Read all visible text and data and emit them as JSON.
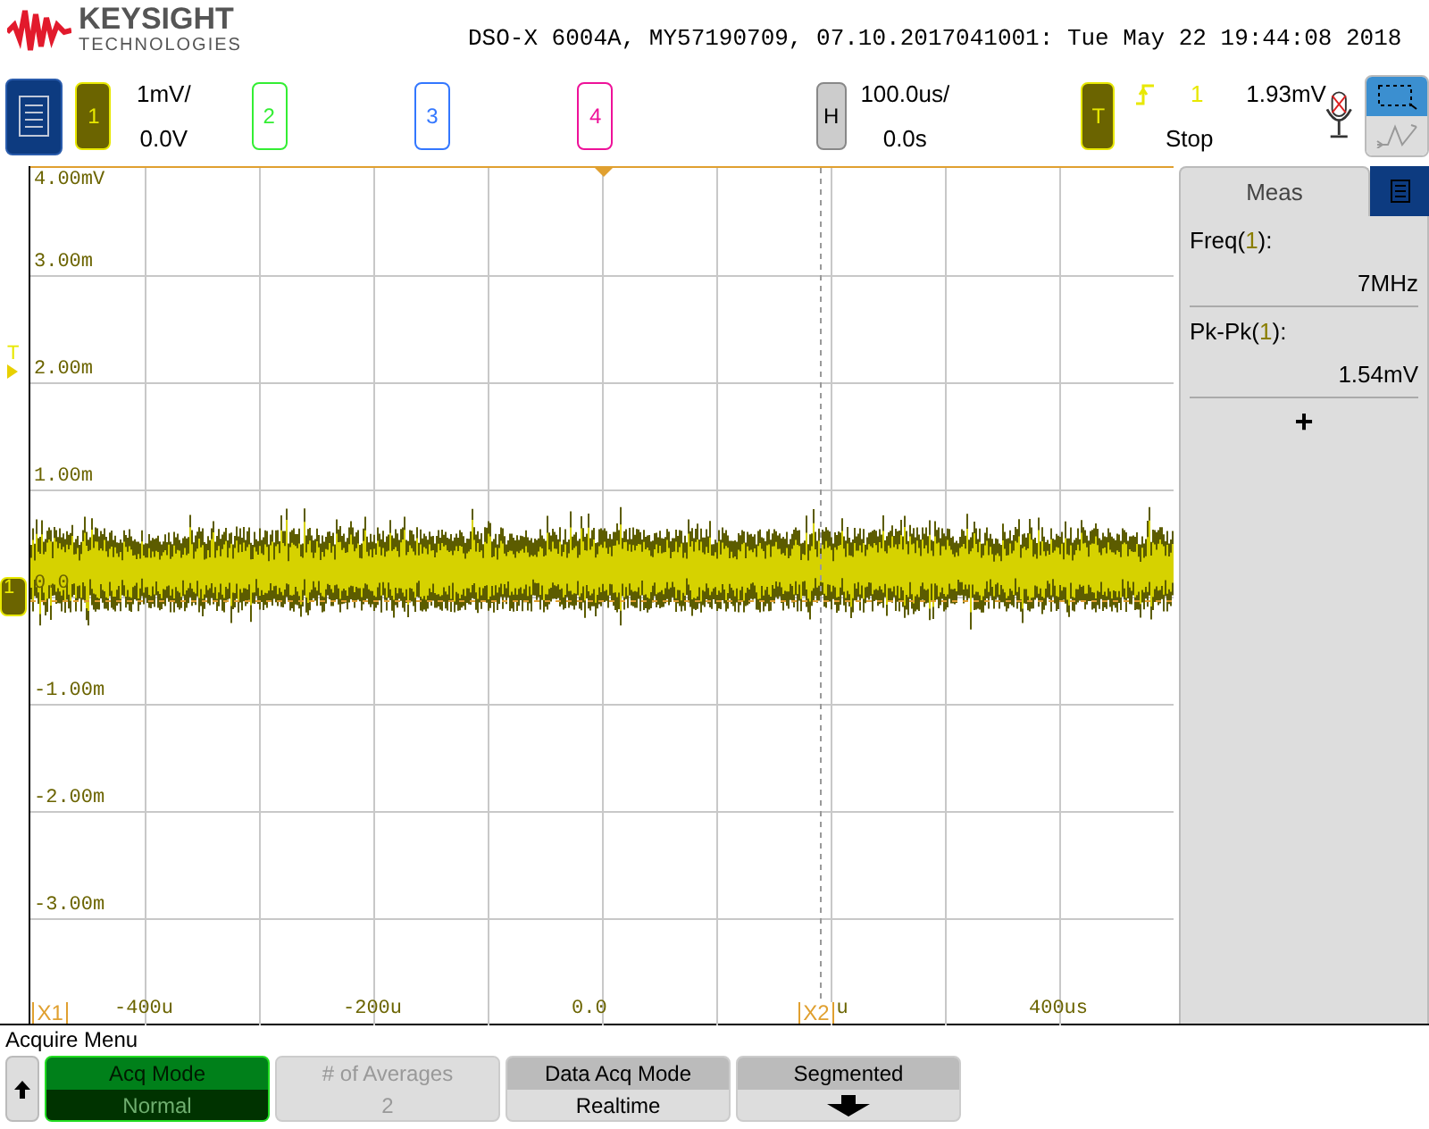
{
  "brand": {
    "name": "KEYSIGHT",
    "subtitle": "TECHNOLOGIES"
  },
  "title": "DSO-X 6004A, MY57190709, 07.10.2017041001: Tue May 22 19:44:08 2018",
  "channels": [
    {
      "label": "1",
      "color": "#e8e800",
      "active": true,
      "scale": "1mV/",
      "offset": "0.0V"
    },
    {
      "label": "2",
      "color": "#33ee33",
      "active": false
    },
    {
      "label": "3",
      "color": "#3377ff",
      "active": false
    },
    {
      "label": "4",
      "color": "#ee1199",
      "active": false
    }
  ],
  "horizontal": {
    "label": "H",
    "scale": "100.0us/",
    "delay": "0.0s"
  },
  "trigger": {
    "label": "T",
    "source": "1",
    "level": "1.93mV",
    "status": "Stop"
  },
  "graticule": {
    "y_labels": [
      "4.00mV",
      "3.00m",
      "2.00m",
      "1.00m",
      "0.0",
      "-1.00m",
      "-2.00m",
      "-3.00m"
    ],
    "x_labels": [
      "-400u",
      "-200u",
      "0.0",
      "400us"
    ],
    "cursors": [
      {
        "label": "X1"
      },
      {
        "label": "X2",
        "suffix": "u"
      }
    ],
    "trigger_marker": "T",
    "ground_marker": "1"
  },
  "meas": {
    "title": "Meas",
    "items": [
      {
        "before": "Freq(",
        "source": "1",
        "after": "):",
        "value": "7MHz"
      },
      {
        "before": "Pk-Pk(",
        "source": "1",
        "after": "):",
        "value": "1.54mV"
      }
    ],
    "add": "+"
  },
  "menu_title": "Acquire Menu",
  "softkeys": [
    {
      "kind": "back"
    },
    {
      "kind": "toggle",
      "title": "Acq Mode",
      "value": "Normal",
      "selected": true,
      "disabled": false
    },
    {
      "kind": "value",
      "title": "# of Averages",
      "value": "2",
      "selected": false,
      "disabled": true
    },
    {
      "kind": "value",
      "title": "Data Acq Mode",
      "value": "Realtime",
      "selected": false,
      "disabled": false
    },
    {
      "kind": "submenu",
      "title": "Segmented",
      "selected": false,
      "disabled": false
    }
  ]
}
